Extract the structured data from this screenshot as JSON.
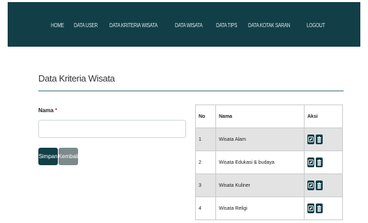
{
  "nav": {
    "items": [
      {
        "label": "HOME"
      },
      {
        "label": "DATA USER"
      },
      {
        "label": "DATA KRITERIA WISATA"
      },
      {
        "label": "DATA WISATA"
      },
      {
        "label": "DATA TIPS"
      },
      {
        "label": "DATA KOTAK SARAN"
      },
      {
        "label": "LOGOUT"
      }
    ]
  },
  "page": {
    "title": "Data Kriteria Wisata"
  },
  "form": {
    "nama_label": "Nama",
    "required_mark": "*",
    "nama_value": "",
    "nama_placeholder": "",
    "save_label": "Simpan",
    "back_label": "Kembali"
  },
  "table": {
    "headers": {
      "no": "No",
      "nama": "Nama",
      "aksi": "Aksi"
    },
    "rows": [
      {
        "no": "1",
        "nama": "Wisata Alam",
        "actions": [
          "edit-icon",
          "trash-icon"
        ]
      },
      {
        "no": "2",
        "nama": "Wisata Edukasi & budaya",
        "actions": [
          "edit-icon",
          "trash-icon"
        ]
      },
      {
        "no": "3",
        "nama": "Wisata Kuliner",
        "actions": [
          "edit-icon",
          "trash-icon"
        ]
      },
      {
        "no": "4",
        "nama": "Wisata Religi",
        "actions": [
          "edit-icon",
          "trash-icon"
        ]
      }
    ]
  },
  "colors": {
    "primary": "#123f47",
    "secondary": "#7d8a8b",
    "row_alt": "#e3e3e3"
  }
}
